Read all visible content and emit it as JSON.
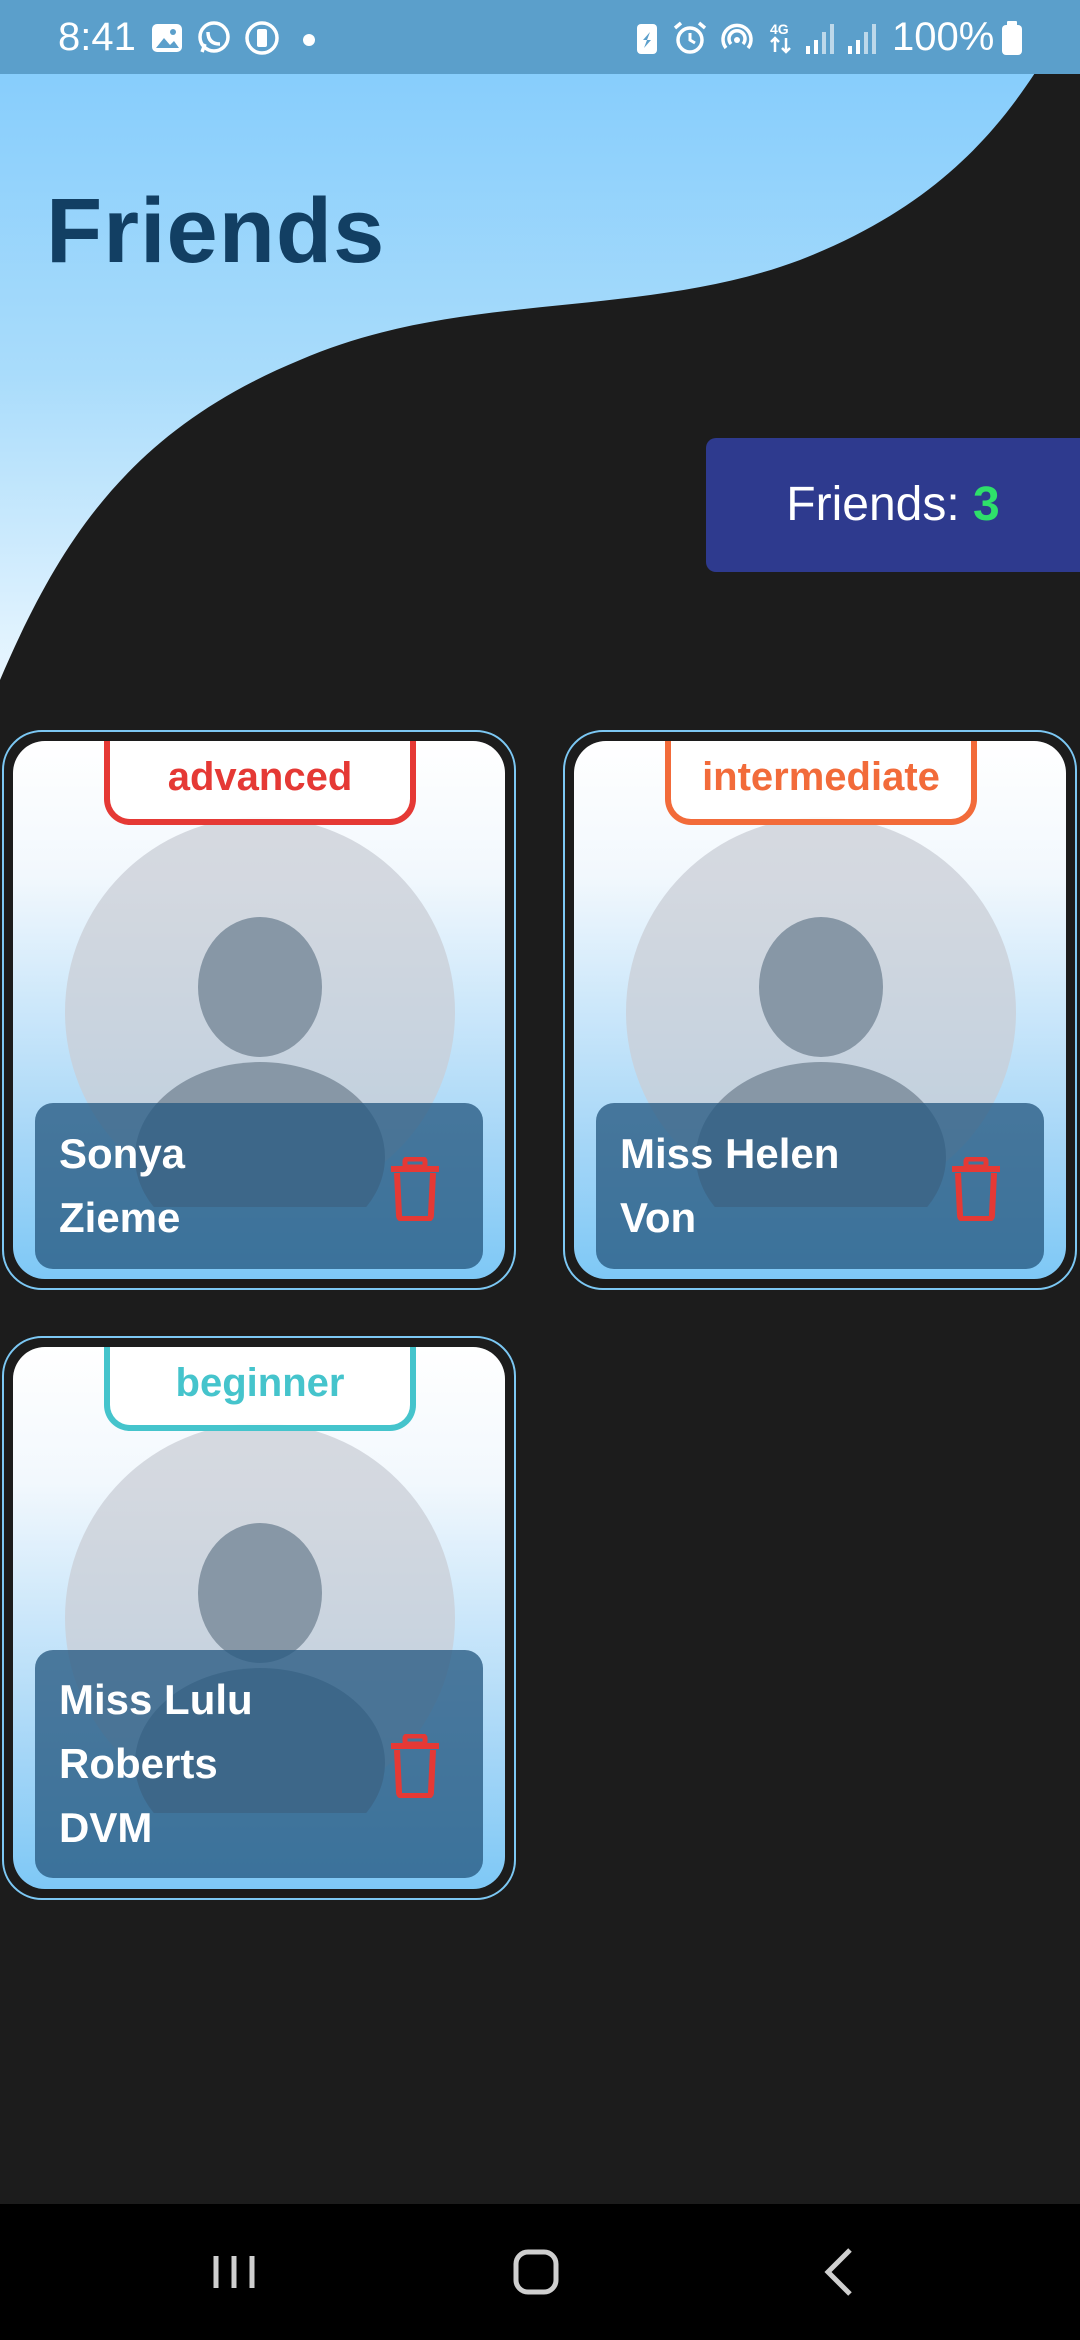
{
  "status_bar": {
    "time": "8:41",
    "battery": "100%",
    "left_icons": [
      "gallery-icon",
      "whatsapp-icon",
      "battery-saver-icon",
      "dot-icon"
    ],
    "right_icons": [
      "battery-share-icon",
      "alarm-icon",
      "hotspot-icon",
      "4g-icon",
      "signal-icon",
      "signal-icon",
      "battery-icon"
    ]
  },
  "header": {
    "title": "Friends"
  },
  "counter": {
    "label": "Friends: ",
    "value": "3"
  },
  "friends": [
    {
      "name_line1": "Sonya",
      "name_line2": "Zieme",
      "name_line3": "",
      "level": "advanced",
      "level_color": "#e53935"
    },
    {
      "name_line1": "Miss Helen",
      "name_line2": "Von",
      "name_line3": "",
      "level": "intermediate",
      "level_color": "#f26b3a"
    },
    {
      "name_line1": "Miss Lulu",
      "name_line2": "Roberts",
      "name_line3": "DVM",
      "level": "beginner",
      "level_color": "#45c4cc"
    }
  ],
  "colors": {
    "hero_light": "#88cefc",
    "background": "#1c1c1c",
    "title": "#123f63",
    "counter_bg": "#2e3a8e",
    "count_value": "#2ee06a",
    "delete_icon": "#e53935",
    "card_border": "#7cc8f4"
  },
  "nav": {
    "buttons": [
      "recent-apps-icon",
      "home-icon",
      "back-icon"
    ]
  }
}
